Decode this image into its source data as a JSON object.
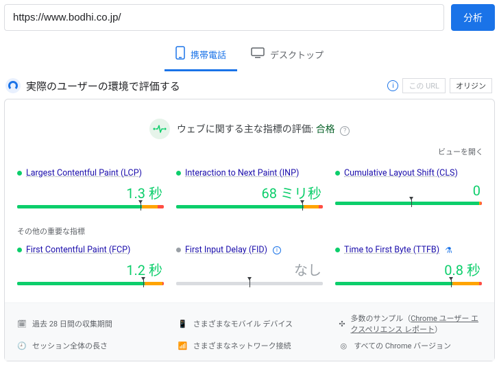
{
  "top": {
    "url": "https://www.bodhi.co.jp/",
    "analyze": "分析"
  },
  "tabs": {
    "mobile": "携帯電話",
    "desktop": "デスクトップ"
  },
  "header": {
    "title": "実際のユーザーの環境で評価する",
    "chip_url": "この URL",
    "chip_origin": "オリジン"
  },
  "cwv": {
    "text": "ウェブに関する主な指標の評価:",
    "status": "合格",
    "open_view": "ビューを開く"
  },
  "metrics": {
    "lcp": {
      "name": "Largest Contentful Paint (LCP)",
      "value": "1.3 秒"
    },
    "inp": {
      "name": "Interaction to Next Paint (INP)",
      "value": "68 ミリ秒"
    },
    "cls": {
      "name": "Cumulative Layout Shift (CLS)",
      "value": "0"
    }
  },
  "other_title": "その他の重要な指標",
  "other": {
    "fcp": {
      "name": "First Contentful Paint (FCP)",
      "value": "1.2 秒"
    },
    "fid": {
      "name": "First Input Delay (FID)",
      "value": "なし"
    },
    "ttfb": {
      "name": "Time to First Byte (TTFB)",
      "value": "0.8 秒"
    }
  },
  "footer": {
    "period": "過去 28 日間の収集期間",
    "devices": "さまざまなモバイル デバイス",
    "samples_prefix": "多数のサンプル（",
    "samples_link": "Chrome ユーザー エクスペリエンス レポート",
    "samples_suffix": "）",
    "session": "セッション全体の長さ",
    "network": "さまざまなネットワーク接続",
    "chrome": "すべての Chrome バージョン"
  }
}
